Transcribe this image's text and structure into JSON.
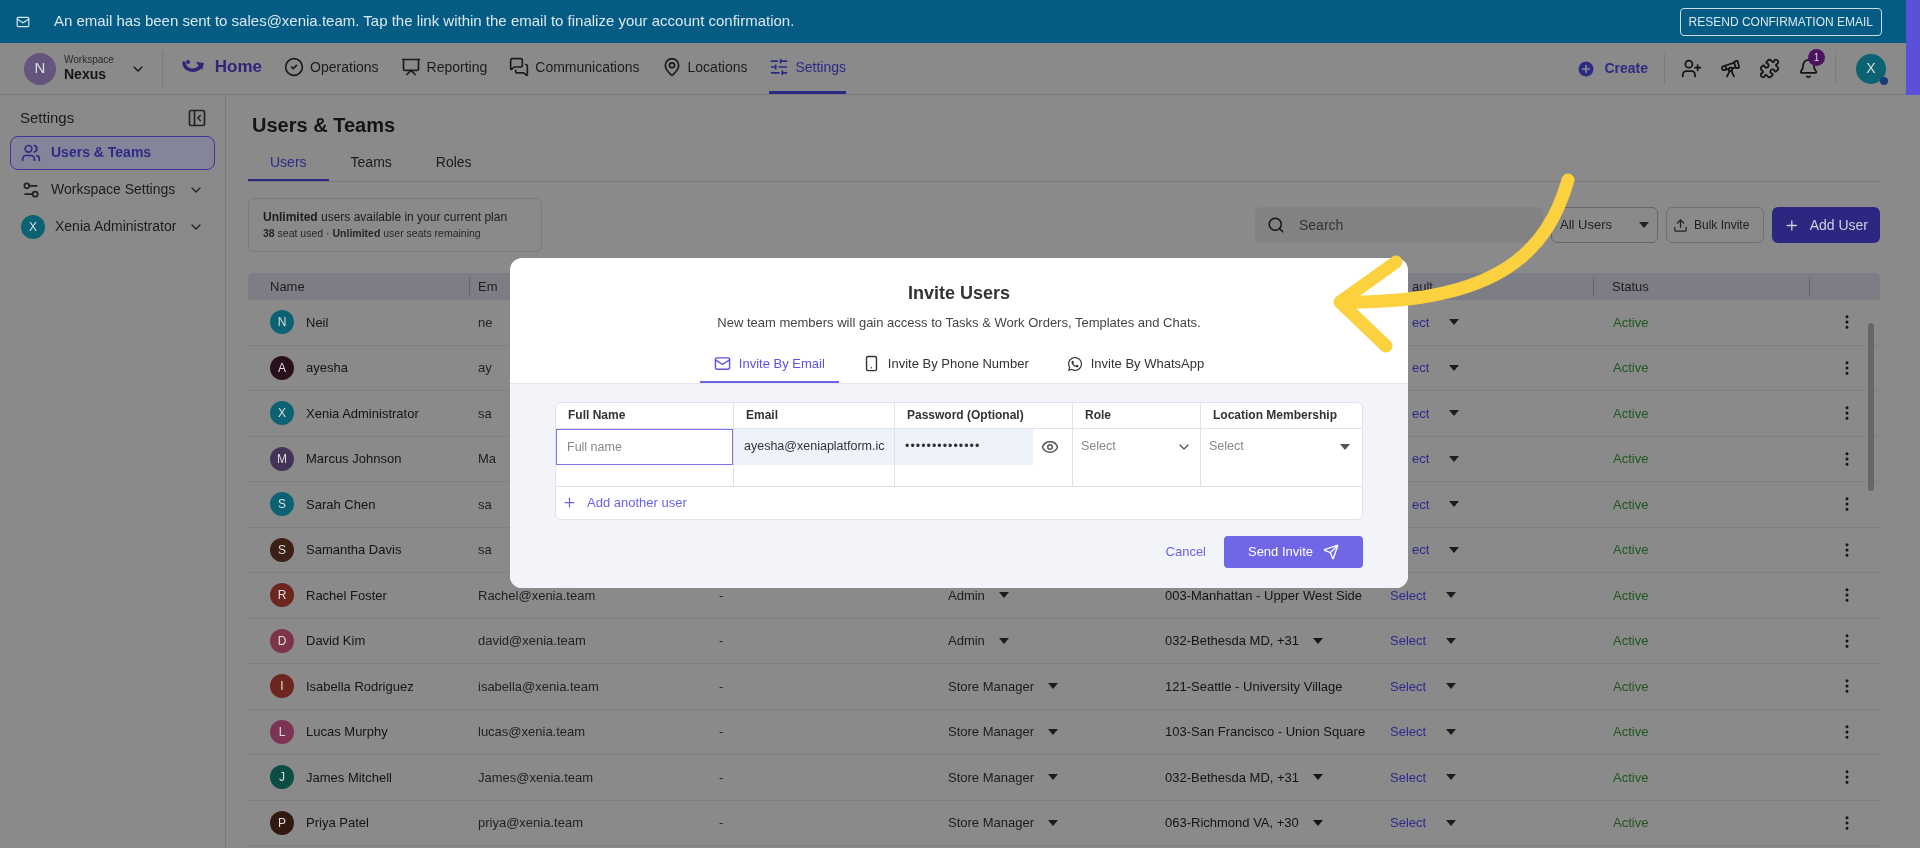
{
  "banner": {
    "message": "An email has been sent to sales@xenia.team. Tap the link within the email to finalize your account confirmation.",
    "button": "RESEND CONFIRMATION EMAIL"
  },
  "workspace": {
    "avatar": "N",
    "label": "Workspace",
    "name": "Nexus"
  },
  "nav": [
    {
      "label": "Home",
      "kind": "home",
      "selected": false
    },
    {
      "label": "Operations",
      "kind": "operations",
      "selected": false
    },
    {
      "label": "Reporting",
      "kind": "reporting",
      "selected": false
    },
    {
      "label": "Communications",
      "kind": "communications",
      "selected": false
    },
    {
      "label": "Locations",
      "kind": "locations",
      "selected": false
    },
    {
      "label": "Settings",
      "kind": "settings",
      "selected": true
    }
  ],
  "create": "Create",
  "notifications": "1",
  "user_avatar": "X",
  "sidebar": {
    "title": "Settings",
    "items": [
      {
        "label": "Users & Teams",
        "kind": "users",
        "selected": true
      },
      {
        "label": "Workspace Settings",
        "kind": "workspace",
        "selected": false
      },
      {
        "label": "Xenia Administrator",
        "kind": "avatar",
        "avatar": "X",
        "selected": false
      }
    ]
  },
  "page_title": "Users & Teams",
  "tabs": [
    {
      "label": "Users",
      "selected": true
    },
    {
      "label": "Teams",
      "selected": false
    },
    {
      "label": "Roles",
      "selected": false
    }
  ],
  "plan": {
    "headline": "**Unlimited** users available in your current plan",
    "detail": "**38** seat used · **Unlimited** user seats remaining"
  },
  "search": {
    "placeholder": "Search"
  },
  "filter": "All Users",
  "bulk_invite": "Bulk Invite",
  "add_user": "Add User",
  "table": {
    "header": {
      "name": "Name",
      "email": "Em",
      "default_location": "ault",
      "status": "Status"
    },
    "rows": [
      {
        "kind": "covered",
        "avatar": "N",
        "color": "#0a6272",
        "name": "Neil",
        "email": "ne",
        "default_location": "ect",
        "status": "Active"
      },
      {
        "kind": "covered",
        "avatar": "A",
        "color": "#29101c",
        "name": "ayesha",
        "email": "ay",
        "default_location": "ect",
        "status": "Active"
      },
      {
        "kind": "covered",
        "avatar": "X",
        "color": "#0a6272",
        "name": "Xenia Administrator",
        "email": "sa",
        "default_location": "ect",
        "status": "Active"
      },
      {
        "kind": "covered",
        "avatar": "M",
        "color": "#443357",
        "name": "Marcus Johnson",
        "email": "Ma",
        "default_location": "ect",
        "status": "Active"
      },
      {
        "kind": "covered",
        "avatar": "S",
        "color": "#0a6272",
        "name": "Sarah Chen",
        "email": "sa",
        "default_location": "ect",
        "status": "Active"
      },
      {
        "kind": "covered",
        "avatar": "S",
        "color": "#3c2015",
        "name": "Samantha Davis",
        "email": "sa",
        "default_location": "ect",
        "status": "Active"
      },
      {
        "kind": "full",
        "avatar": "R",
        "color": "#6d2520",
        "name": "Rachel Foster",
        "email": "Rachel@xenia.team",
        "phone": "-",
        "role": "Admin",
        "location": "003-Manhattan - Upper West Side",
        "location_menu": false,
        "default_location": "Select",
        "status": "Active"
      },
      {
        "kind": "full",
        "avatar": "D",
        "color": "#7d3348",
        "name": "David Kim",
        "email": "david@xenia.team",
        "phone": "-",
        "role": "Admin",
        "location": "032-Bethesda MD, +31",
        "location_menu": true,
        "default_location": "Select",
        "status": "Active"
      },
      {
        "kind": "full",
        "avatar": "I",
        "color": "#6d2520",
        "name": "Isabella Rodriguez",
        "email": "isabella@xenia.team",
        "phone": "-",
        "role": "Store Manager",
        "location": "121-Seattle - University Village",
        "location_menu": false,
        "default_location": "Select",
        "status": "Active"
      },
      {
        "kind": "full",
        "avatar": "L",
        "color": "#7d3355",
        "name": "Lucas Murphy",
        "email": "lucas@xenia.team",
        "phone": "-",
        "role": "Store Manager",
        "location": "103-San Francisco - Union Square",
        "location_menu": false,
        "default_location": "Select",
        "status": "Active"
      },
      {
        "kind": "full",
        "avatar": "J",
        "color": "#0b4c45",
        "name": "James Mitchell",
        "email": "James@xenia.team",
        "phone": "-",
        "role": "Store Manager",
        "location": "032-Bethesda MD, +31",
        "location_menu": true,
        "default_location": "Select",
        "status": "Active"
      },
      {
        "kind": "full",
        "avatar": "P",
        "color": "#31190f",
        "name": "Priya Patel",
        "email": "priya@xenia.team",
        "phone": "-",
        "role": "Store Manager",
        "location": "063-Richmond VA, +30",
        "location_menu": true,
        "default_location": "Select",
        "status": "Active"
      }
    ]
  },
  "modal": {
    "title": "Invite Users",
    "subtitle": "New team members will gain access to Tasks & Work Orders, Templates and Chats.",
    "tabs": [
      {
        "label": "Invite By Email",
        "kind": "email",
        "selected": true
      },
      {
        "label": "Invite By Phone Number",
        "kind": "phone",
        "selected": false
      },
      {
        "label": "Invite By WhatsApp",
        "kind": "whatsapp",
        "selected": false
      }
    ],
    "columns": [
      "Full Name",
      "Email",
      "Password (Optional)",
      "Role",
      "Location Membership"
    ],
    "full_name": {
      "placeholder": "Full name"
    },
    "email": "ayesha@xeniaplatform.ic",
    "password": "••••••••••••••",
    "role": {
      "placeholder": "Select"
    },
    "location": {
      "placeholder": "Select"
    },
    "add_another": "Add another user",
    "cancel": "Cancel",
    "send": "Send Invite"
  }
}
